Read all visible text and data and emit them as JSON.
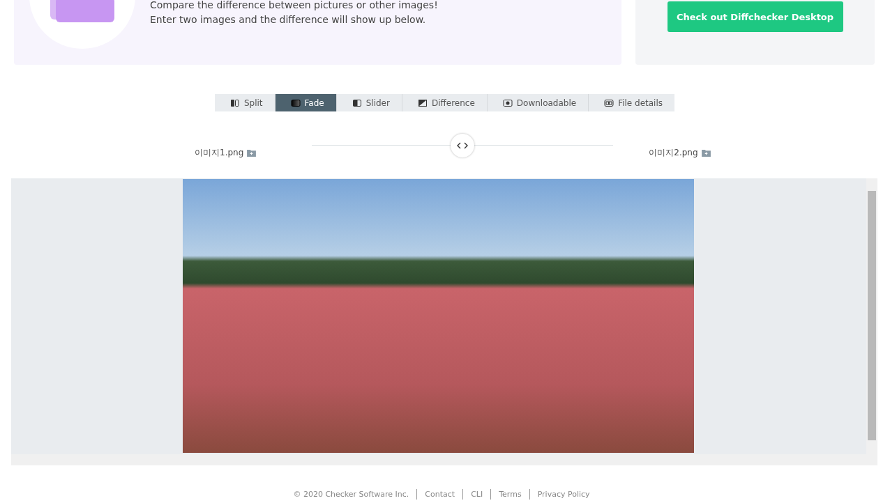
{
  "intro": {
    "lines": [
      "Compare the difference between pictures or other images!",
      "Enter two images and the difference will show up below."
    ]
  },
  "promo": {
    "button": "Check out Diffchecker Desktop"
  },
  "tabs": [
    {
      "label": "Split",
      "selected": false,
      "kind": "split"
    },
    {
      "label": "Fade",
      "selected": true,
      "kind": "fade"
    },
    {
      "label": "Slider",
      "selected": false,
      "kind": "slider"
    },
    {
      "label": "Difference",
      "selected": false,
      "kind": "difference"
    },
    {
      "label": "Downloadable",
      "selected": false,
      "kind": "download"
    },
    {
      "label": "File details",
      "selected": false,
      "kind": "details"
    }
  ],
  "fade": {
    "left_file": "이미지1.png",
    "right_file": "이미지2.png",
    "level": 0.5
  },
  "footer": {
    "copyright": "© 2020 Checker Software Inc.",
    "links": [
      "Contact",
      "CLI",
      "Terms",
      "Privacy Policy"
    ]
  }
}
